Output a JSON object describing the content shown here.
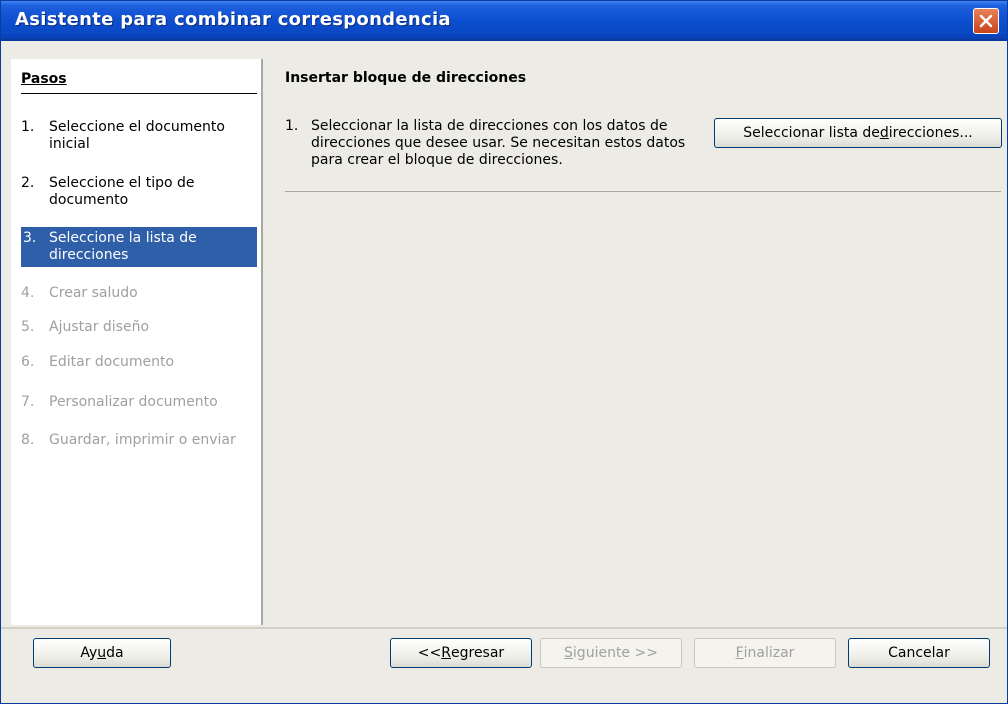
{
  "window": {
    "title": "Asistente para combinar correspondencia"
  },
  "steps": {
    "header": "Pasos",
    "items": [
      {
        "num": "1.",
        "label": "Seleccione el documento inicial",
        "state": "done"
      },
      {
        "num": "2.",
        "label": "Seleccione el tipo de documento",
        "state": "done"
      },
      {
        "num": "3.",
        "label": "Seleccione la lista de direcciones",
        "state": "active"
      },
      {
        "num": "4.",
        "label": "Crear saludo",
        "state": "disabled"
      },
      {
        "num": "5.",
        "label": "Ajustar diseño",
        "state": "disabled"
      },
      {
        "num": "6.",
        "label": "Editar documento",
        "state": "disabled"
      },
      {
        "num": "7.",
        "label": "Personalizar documento",
        "state": "disabled"
      },
      {
        "num": "8.",
        "label": "Guardar, imprimir o enviar",
        "state": "disabled"
      }
    ]
  },
  "content": {
    "title": "Insertar bloque de direcciones",
    "item_num": "1.",
    "item_text": "Seleccionar la lista de direcciones con los datos de direcciones que desee usar. Se necesitan estos datos para crear el bloque de direcciones.",
    "select_button": {
      "before": "Seleccionar lista de ",
      "mnemonic": "d",
      "after": "irecciones..."
    }
  },
  "buttons": {
    "help": {
      "before": "Ay",
      "mnemonic": "u",
      "after": "da"
    },
    "back": {
      "before": "<< ",
      "mnemonic": "R",
      "after": "egresar"
    },
    "next": {
      "before": "",
      "mnemonic": "S",
      "after": "iguiente >>"
    },
    "finish": {
      "before": "",
      "mnemonic": "F",
      "after": "inalizar"
    },
    "cancel": {
      "before": "Cancelar",
      "mnemonic": "",
      "after": ""
    }
  },
  "icons": {
    "close": "close-icon"
  },
  "colors": {
    "titlebar": "#0d4fd0",
    "active_step": "#2f5fa9",
    "disabled_text": "#a0a0a0"
  }
}
